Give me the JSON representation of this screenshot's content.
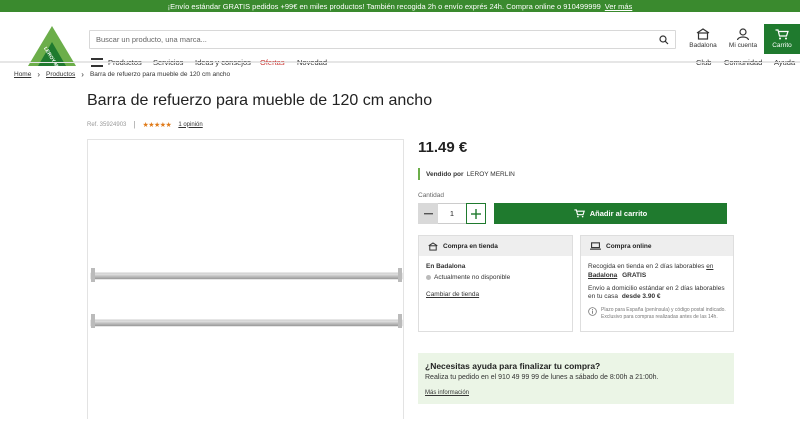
{
  "promo": {
    "text": "¡Envío estándar GRATIS pedidos +99€ en miles productos! También recogida 2h o envío exprés 24h. Compra online o 910499999",
    "link": "Ver más"
  },
  "header": {
    "logo_text": "LEROY MERLIN",
    "search_placeholder": "Buscar un producto, una marca...",
    "store_label": "Badalona",
    "account_label": "Mi cuenta",
    "cart_label": "Carrito"
  },
  "nav": {
    "products": "Productos",
    "services": "Servicios",
    "ideas": "Ideas y consejos",
    "offers": "Ofertas",
    "news": "Novedad",
    "club": "Club",
    "community": "Comunidad",
    "help": "Ayuda"
  },
  "breadcrumb": {
    "home": "Home",
    "products": "Productos",
    "current": "Barra de refuerzo para mueble de 120 cm ancho"
  },
  "product": {
    "title": "Barra de refuerzo para mueble de 120 cm ancho",
    "ref": "Ref. 35924903",
    "rating": 4.5,
    "reviews": "1 opinión",
    "price": "11.49 €",
    "sold_by_label": "Vendido por",
    "sold_by": "LEROY MERLIN",
    "qty_label": "Cantidad",
    "qty": "1",
    "add_to_cart": "Añadir al carrito"
  },
  "store_card": {
    "title": "Compra en tienda",
    "store": "En Badalona",
    "status": "Actualmente no disponible",
    "change": "Cambiar de tienda"
  },
  "online_card": {
    "title": "Compra online",
    "pickup_pre": "Recogida en tienda en 2 días laborables",
    "pickup_en": "en",
    "pickup_store": "Badalona",
    "pickup_price": "GRATIS",
    "delivery_pre": "Envío a domicilio estándar en 2 días laborables",
    "delivery_mid": "en tu casa",
    "delivery_price": "desde 3.90 €",
    "note": "Plazo para España (península) y código postal indicado. Exclusivo para compras realizadas antes de las 14h."
  },
  "help": {
    "heading": "¿Necesitas ayuda para finalizar tu compra?",
    "text": "Realiza tu pedido en el 910 49 99 99 de lunes a sábado de 8:00h a 21:00h.",
    "link": "Más información"
  },
  "colors": {
    "brand_green": "#1f7a2e",
    "promo_green": "#3a8a2e",
    "offer_red": "#c9322e",
    "star_orange": "#e07b1a"
  }
}
